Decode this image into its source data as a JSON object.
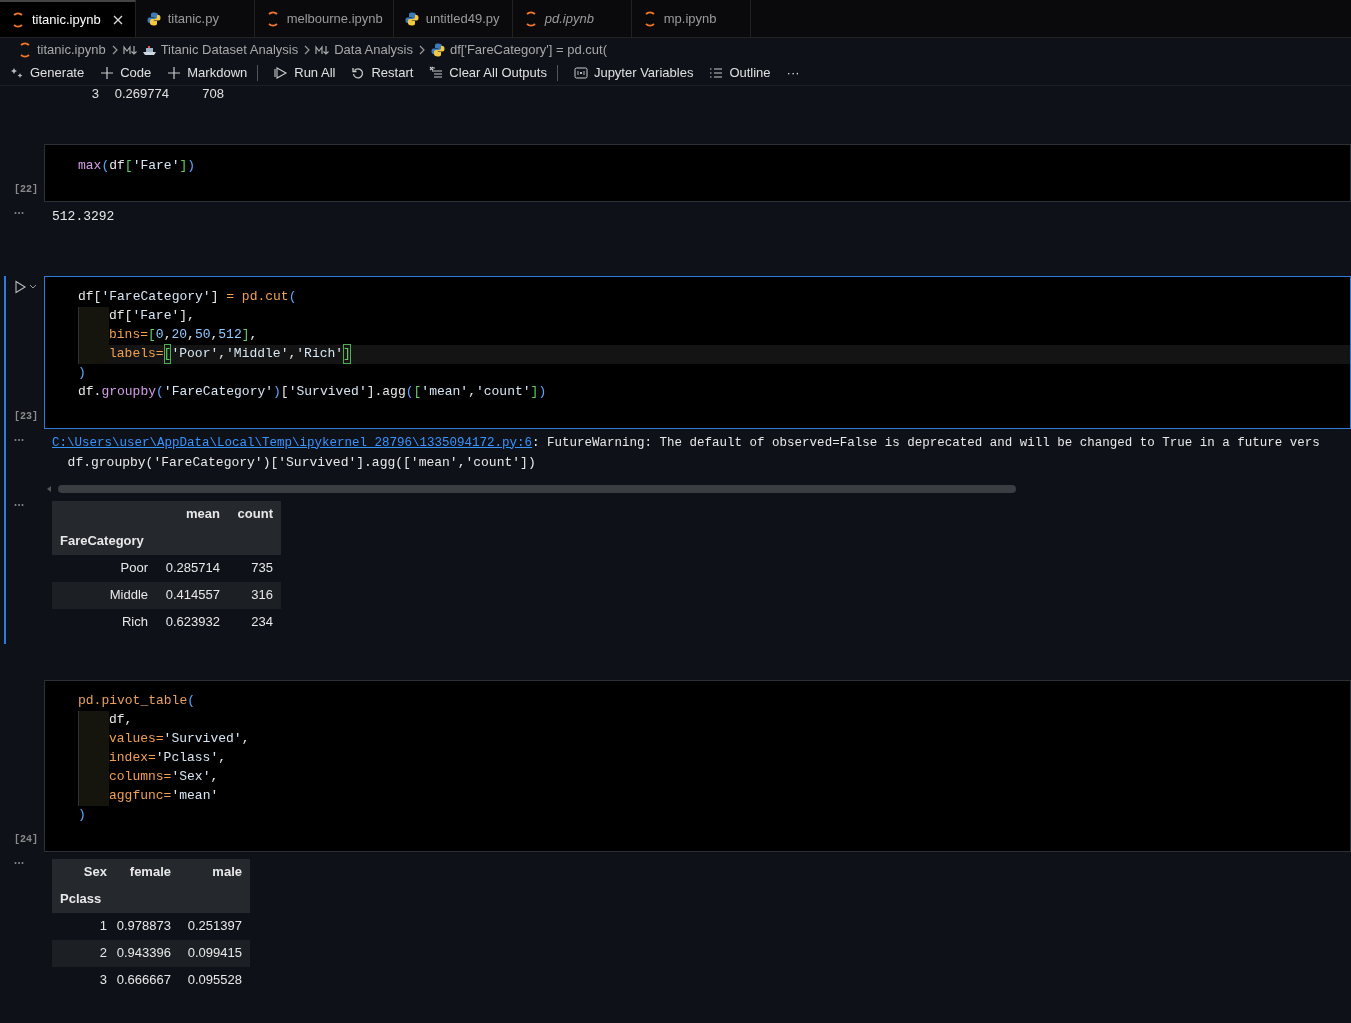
{
  "tabs": [
    {
      "label": "titanic.ipynb",
      "kind": "notebook",
      "selected": true,
      "preview": false
    },
    {
      "label": "titanic.py",
      "kind": "python",
      "selected": false,
      "preview": false
    },
    {
      "label": "melbourne.ipynb",
      "kind": "notebook",
      "selected": false,
      "preview": false
    },
    {
      "label": "untitled49.py",
      "kind": "python",
      "selected": false,
      "preview": false
    },
    {
      "label": "pd.ipynb",
      "kind": "notebook",
      "selected": false,
      "preview": true
    },
    {
      "label": "mp.ipynb",
      "kind": "notebook",
      "selected": false,
      "preview": false
    }
  ],
  "breadcrumbs": [
    {
      "label": "titanic.ipynb",
      "kind": "notebook"
    },
    {
      "label": "Titanic Dataset Analysis",
      "kind": "heading-ship"
    },
    {
      "label": "Data Analysis",
      "kind": "heading"
    },
    {
      "label": "df['FareCategory'] = pd.cut(",
      "kind": "python"
    }
  ],
  "toolbar": [
    {
      "label": "Generate",
      "kind": "generate",
      "divider_before": false
    },
    {
      "label": "Code",
      "kind": "add",
      "divider_before": false
    },
    {
      "label": "Markdown",
      "kind": "add",
      "divider_before": false
    },
    {
      "label": "Run All",
      "kind": "run",
      "divider_before": true
    },
    {
      "label": "Restart",
      "kind": "restart",
      "divider_before": false
    },
    {
      "label": "Clear All Outputs",
      "kind": "clear",
      "divider_before": false
    },
    {
      "label": "Jupyter Variables",
      "kind": "variables",
      "divider_before": true
    },
    {
      "label": "Outline",
      "kind": "outline",
      "divider_before": false
    },
    {
      "label": "···",
      "kind": "more",
      "divider_before": false
    }
  ],
  "partial_output_row": [
    "3",
    "0.269774",
    "708"
  ],
  "cells": [
    {
      "execution_count": "[22]",
      "focused": false,
      "lines": [
        {
          "guide": false,
          "current": false,
          "tokens": [
            {
              "text": "max",
              "kind": "func"
            },
            {
              "text": "(",
              "kind": "blue"
            },
            {
              "text": "df",
              "kind": "plain"
            },
            {
              "text": "[",
              "kind": "green"
            },
            {
              "text": "'Fare'",
              "kind": "string"
            },
            {
              "text": "]",
              "kind": "green"
            },
            {
              "text": ")",
              "kind": "blue"
            }
          ]
        }
      ],
      "outputs": [
        {
          "kind": "text",
          "text": "512.3292"
        }
      ]
    },
    {
      "execution_count": "[23]",
      "focused": true,
      "lines": [
        {
          "guide": false,
          "current": false,
          "tokens": [
            {
              "text": "df",
              "kind": "plain"
            },
            {
              "text": "[",
              "kind": "plain"
            },
            {
              "text": "'FareCategory'",
              "kind": "string"
            },
            {
              "text": "]",
              "kind": "plain"
            },
            {
              "text": " = ",
              "kind": "orange"
            },
            {
              "text": "pd.cut",
              "kind": "orange"
            },
            {
              "text": "(",
              "kind": "blue"
            }
          ]
        },
        {
          "guide": true,
          "current": false,
          "tokens": [
            {
              "text": "df",
              "kind": "plain"
            },
            {
              "text": "[",
              "kind": "plain"
            },
            {
              "text": "'Fare'",
              "kind": "string"
            },
            {
              "text": "],",
              "kind": "plain"
            }
          ]
        },
        {
          "guide": true,
          "current": false,
          "tokens": [
            {
              "text": "bins=",
              "kind": "orange"
            },
            {
              "text": "[",
              "kind": "green"
            },
            {
              "text": "0",
              "kind": "number"
            },
            {
              "text": ",",
              "kind": "plain"
            },
            {
              "text": "20",
              "kind": "number"
            },
            {
              "text": ",",
              "kind": "plain"
            },
            {
              "text": "50",
              "kind": "number"
            },
            {
              "text": ",",
              "kind": "plain"
            },
            {
              "text": "512",
              "kind": "number"
            },
            {
              "text": "]",
              "kind": "green"
            },
            {
              "text": ",",
              "kind": "plain"
            }
          ]
        },
        {
          "guide": true,
          "current": true,
          "tokens": [
            {
              "text": "labels=",
              "kind": "orange"
            },
            {
              "text": "[",
              "kind": "match"
            },
            {
              "text": "'Poor'",
              "kind": "string"
            },
            {
              "text": ",",
              "kind": "plain"
            },
            {
              "text": "'Middle'",
              "kind": "string"
            },
            {
              "text": ",",
              "kind": "plain"
            },
            {
              "text": "'Rich'",
              "kind": "string"
            },
            {
              "text": "]",
              "kind": "match"
            }
          ]
        },
        {
          "guide": false,
          "current": false,
          "tokens": [
            {
              "text": ")",
              "kind": "blue"
            }
          ]
        },
        {
          "guide": false,
          "current": false,
          "tokens": [
            {
              "text": "df.",
              "kind": "plain"
            },
            {
              "text": "groupby",
              "kind": "func"
            },
            {
              "text": "(",
              "kind": "blue"
            },
            {
              "text": "'FareCategory'",
              "kind": "string"
            },
            {
              "text": ")",
              "kind": "blue"
            },
            {
              "text": "[",
              "kind": "plain"
            },
            {
              "text": "'Survived'",
              "kind": "string"
            },
            {
              "text": "].agg",
              "kind": "plain"
            },
            {
              "text": "(",
              "kind": "blue"
            },
            {
              "text": "[",
              "kind": "green"
            },
            {
              "text": "'mean'",
              "kind": "string"
            },
            {
              "text": ",",
              "kind": "plain"
            },
            {
              "text": "'count'",
              "kind": "string"
            },
            {
              "text": "]",
              "kind": "green"
            },
            {
              "text": ")",
              "kind": "blue"
            }
          ]
        }
      ],
      "outputs": [
        {
          "kind": "warning",
          "link": "C:\\Users\\user\\AppData\\Local\\Temp\\ipykernel_28796\\1335094172.py:6",
          "message": ": FutureWarning: The default of observed=False is deprecated and will be changed to True in a future vers",
          "source": "  df.groupby('FareCategory')['Survived'].agg(['mean','count'])"
        },
        {
          "kind": "table",
          "header": [
            "mean",
            "count"
          ],
          "index_name": "FareCategory",
          "rows": [
            [
              "Poor",
              "0.285714",
              "735"
            ],
            [
              "Middle",
              "0.414557",
              "316"
            ],
            [
              "Rich",
              "0.623932",
              "234"
            ]
          ]
        }
      ]
    },
    {
      "execution_count": "[24]",
      "focused": false,
      "lines": [
        {
          "guide": false,
          "current": false,
          "tokens": [
            {
              "text": "pd.pivot_table",
              "kind": "func2"
            },
            {
              "text": "(",
              "kind": "blue"
            }
          ]
        },
        {
          "guide": true,
          "current": false,
          "tokens": [
            {
              "text": "df,",
              "kind": "plain"
            }
          ]
        },
        {
          "guide": true,
          "current": false,
          "tokens": [
            {
              "text": "values=",
              "kind": "orange"
            },
            {
              "text": "'Survived'",
              "kind": "string"
            },
            {
              "text": ",",
              "kind": "plain"
            }
          ]
        },
        {
          "guide": true,
          "current": false,
          "tokens": [
            {
              "text": "index=",
              "kind": "orange"
            },
            {
              "text": "'Pclass'",
              "kind": "string"
            },
            {
              "text": ",",
              "kind": "plain"
            }
          ]
        },
        {
          "guide": true,
          "current": false,
          "tokens": [
            {
              "text": "columns=",
              "kind": "orange"
            },
            {
              "text": "'Sex'",
              "kind": "string"
            },
            {
              "text": ",",
              "kind": "plain"
            }
          ]
        },
        {
          "guide": true,
          "current": false,
          "tokens": [
            {
              "text": "aggfunc=",
              "kind": "orange"
            },
            {
              "text": "'mean'",
              "kind": "string"
            }
          ]
        },
        {
          "guide": false,
          "current": false,
          "tokens": [
            {
              "text": ")",
              "kind": "blue"
            }
          ]
        }
      ],
      "outputs": [
        {
          "kind": "table",
          "columns_name": "Sex",
          "header": [
            "female",
            "male"
          ],
          "index_name": "Pclass",
          "rows": [
            [
              "1",
              "0.978873",
              "0.251397"
            ],
            [
              "2",
              "0.943396",
              "0.099415"
            ],
            [
              "3",
              "0.666667",
              "0.095528"
            ]
          ]
        }
      ]
    }
  ]
}
